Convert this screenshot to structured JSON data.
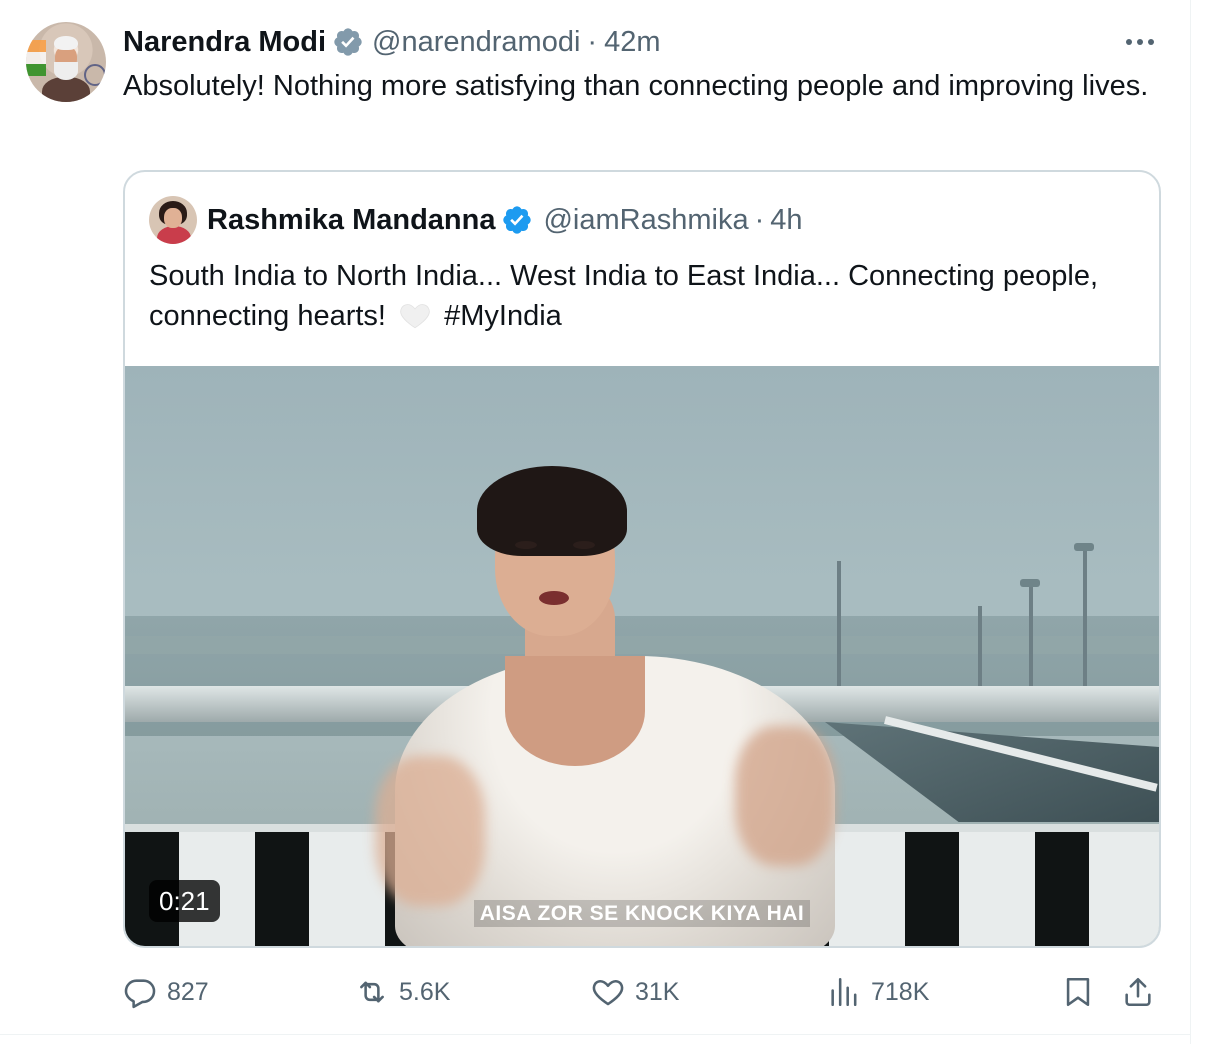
{
  "tweet": {
    "author_name": "Narendra Modi",
    "handle": "@narendramodi",
    "separator": "·",
    "time": "42m",
    "text": "Absolutely! Nothing more satisfying than connecting people and improving lives."
  },
  "quote": {
    "author_name": "Rashmika Mandanna",
    "handle": "@iamRashmika",
    "separator": "·",
    "time": "4h",
    "text_before_heart": "South India to North India... West India to East India... Connecting people, connecting hearts!",
    "hashtag": "#MyIndia",
    "video": {
      "duration": "0:21",
      "subtitle": "AISA ZOR SE KNOCK KIYA HAI"
    }
  },
  "actions": {
    "replies": "827",
    "reposts": "5.6K",
    "likes": "31K",
    "views": "718K"
  },
  "icons": {
    "verified": "verified-badge-icon",
    "more": "more-icon",
    "reply": "reply-icon",
    "repost": "repost-icon",
    "like": "like-icon",
    "views": "views-icon",
    "bookmark": "bookmark-icon",
    "share": "share-icon",
    "heart_emoji": "white-heart-icon"
  },
  "colors": {
    "verified_primary": "#1d9bf0",
    "verified_gray": "#829aab",
    "secondary_text": "#536471",
    "border": "#cfd9de"
  }
}
